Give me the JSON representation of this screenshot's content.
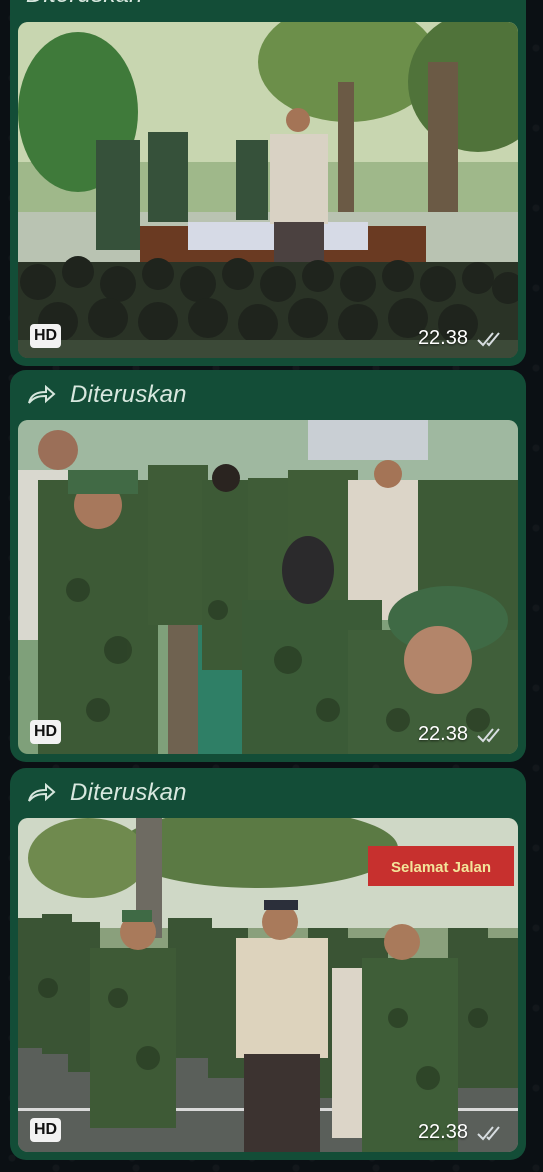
{
  "messages": [
    {
      "forward_label": "Diteruskan",
      "hd_badge": "HD",
      "time": "22.38",
      "ticks_icon": "double-check-icon"
    },
    {
      "forward_label": "Diteruskan",
      "hd_badge": "HD",
      "time": "22.38",
      "ticks_icon": "double-check-icon"
    },
    {
      "forward_label": "Diteruskan",
      "hd_badge": "HD",
      "time": "22.38",
      "ticks_icon": "double-check-icon",
      "photo_sign_text": "Selamat Jalan"
    }
  ],
  "colors": {
    "bubble": "#134d37",
    "background": "#0b1014",
    "forward_text": "#d8e8df"
  }
}
